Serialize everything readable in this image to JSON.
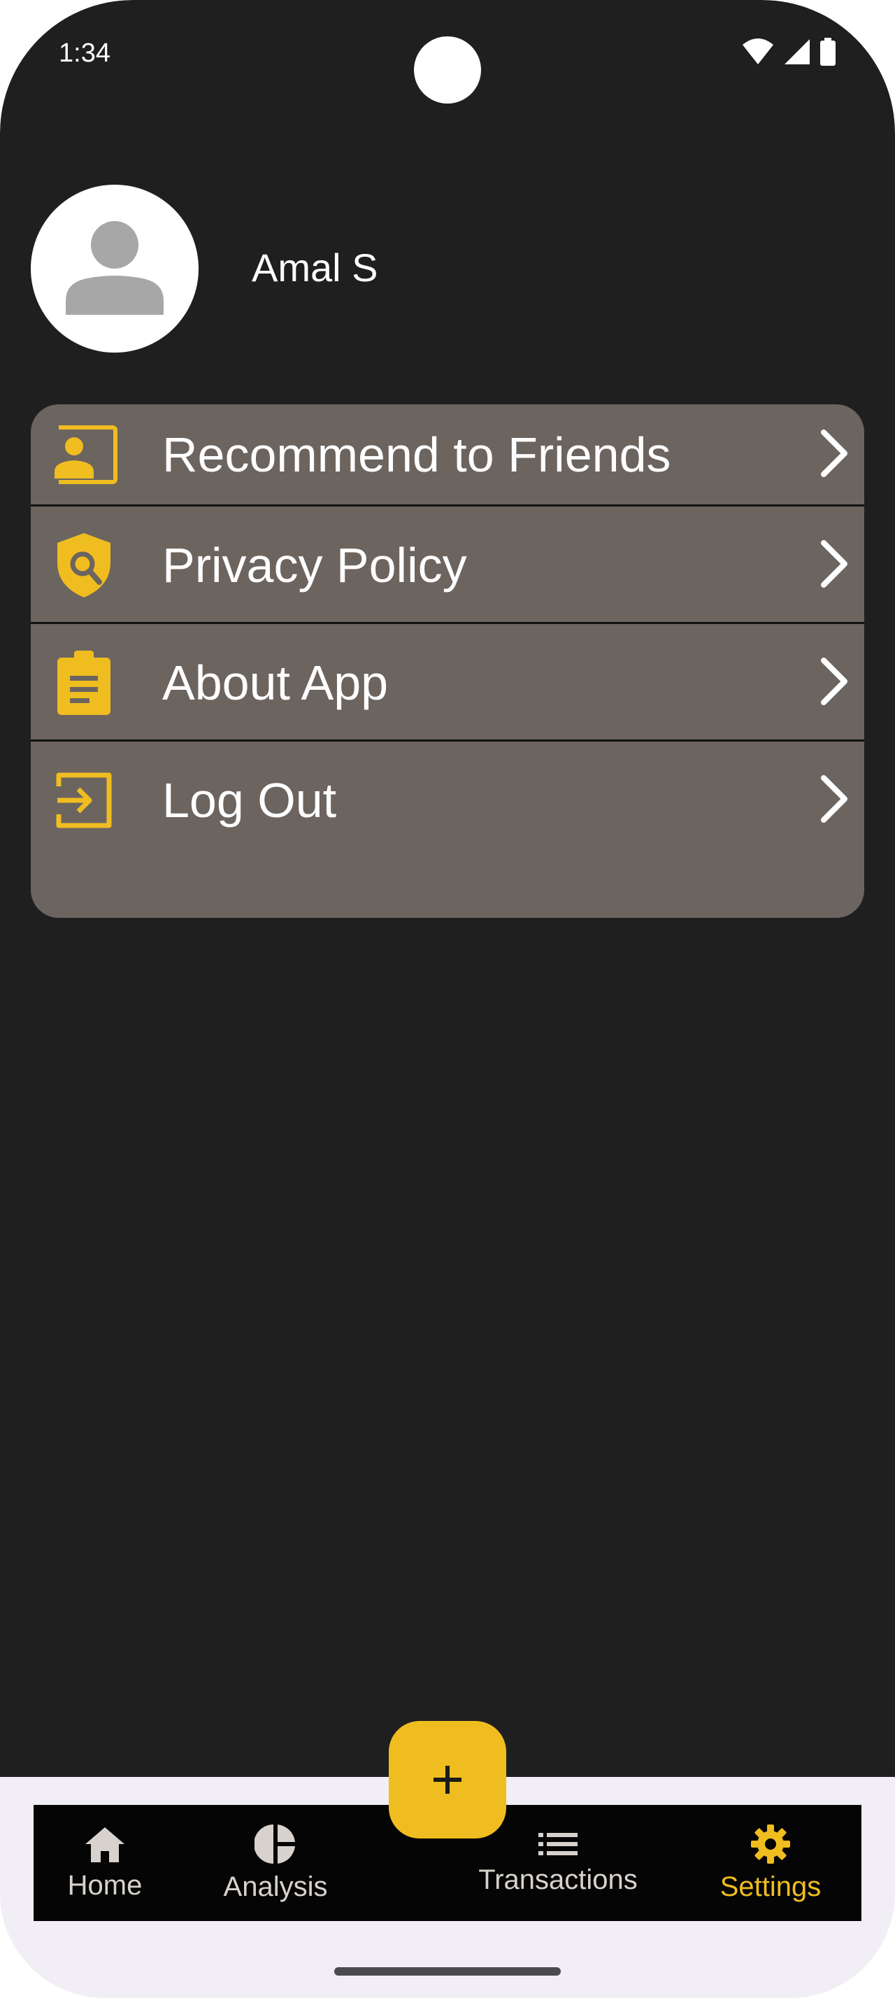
{
  "status_bar": {
    "time": "1:34",
    "icons": [
      "wifi-icon",
      "signal-icon",
      "battery-icon"
    ]
  },
  "profile": {
    "name": "Amal S",
    "avatar_icon": "person-icon"
  },
  "menu": {
    "items": [
      {
        "label": "Recommend to Friends",
        "icon": "contact-card-icon"
      },
      {
        "label": "Privacy Policy",
        "icon": "shield-search-icon"
      },
      {
        "label": "About App",
        "icon": "clipboard-icon"
      },
      {
        "label": "Log Out",
        "icon": "logout-icon"
      }
    ]
  },
  "fab": {
    "icon": "plus-icon"
  },
  "bottom_nav": {
    "items": [
      {
        "label": "Home",
        "icon": "home-icon",
        "active": false
      },
      {
        "label": "Analysis",
        "icon": "pie-chart-icon",
        "active": false
      },
      {
        "label": "Transactions",
        "icon": "list-icon",
        "active": false
      },
      {
        "label": "Settings",
        "icon": "gear-icon",
        "active": true
      }
    ]
  },
  "colors": {
    "background": "#201f20",
    "card": "#6c645f",
    "accent": "#f0bd20",
    "nav_background": "#050505",
    "nav_text": "#d7d2cd"
  }
}
